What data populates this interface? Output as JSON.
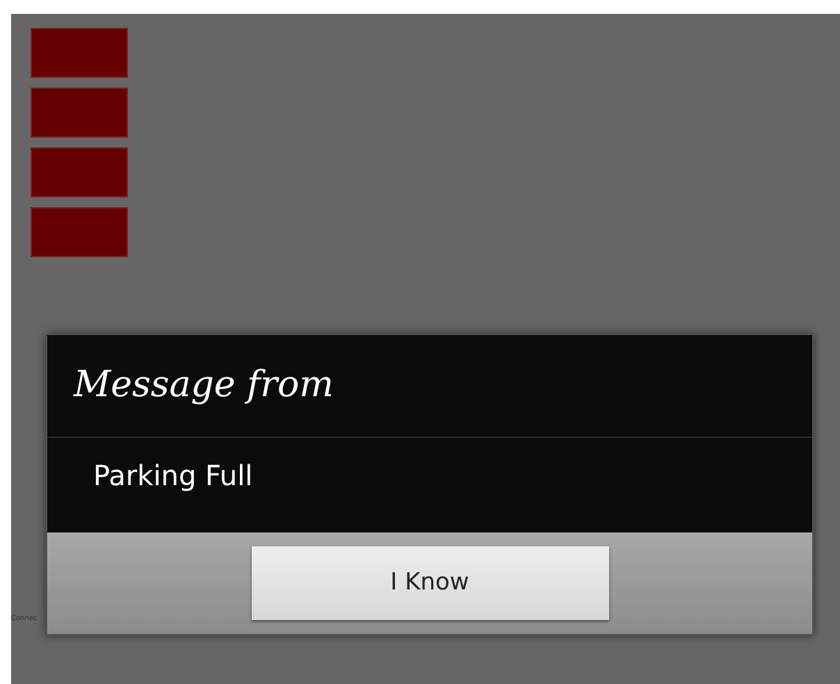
{
  "side_buttons": [
    {
      "kind": "button"
    },
    {
      "kind": "button"
    },
    {
      "kind": "button"
    },
    {
      "kind": "button"
    }
  ],
  "status_text": "Connec",
  "dialog": {
    "title": "Message from",
    "message": "Parking Full",
    "button": "I Know"
  }
}
